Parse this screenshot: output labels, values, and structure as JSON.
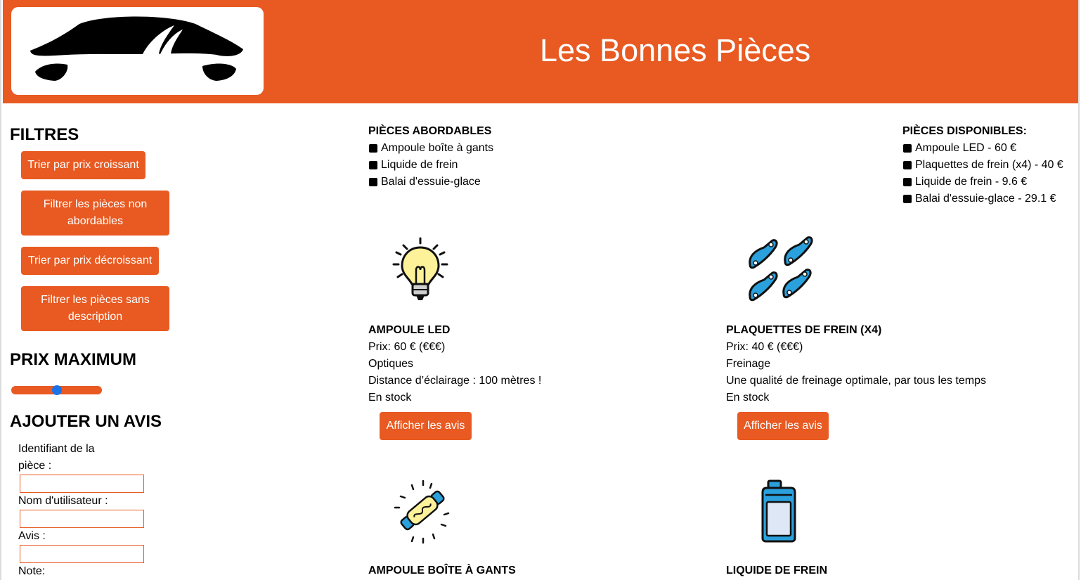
{
  "header": {
    "title": "Les Bonnes Pièces",
    "logo_icon": "car-silhouette-icon",
    "accent_color": "#e85a22"
  },
  "sidebar": {
    "filters_title": "FILTRES",
    "buttons": {
      "sort_asc": "Trier par prix croissant",
      "filter_unaffordable": "Filtrer les pièces non abordables",
      "sort_desc": "Trier par prix décroissant",
      "filter_no_description": "Filtrer les pièces sans description"
    },
    "price_max_title": "PRIX MAXIMUM",
    "price_slider_fraction": 0.5,
    "review_title": "AJOUTER UN AVIS",
    "form": {
      "piece_id_label": "Identifiant de la pièce :",
      "username_label": "Nom d'utilisateur :",
      "review_label": "Avis :",
      "note_label": "Note:"
    }
  },
  "affordable": {
    "title": "PIÈCES ABORDABLES",
    "items": [
      "Ampoule boîte à gants",
      "Liquide de frein",
      "Balai d'essuie-glace"
    ]
  },
  "available": {
    "title": "PIÈCES DISPONIBLES:",
    "items": [
      "Ampoule LED - 60 €",
      "Plaquettes de frein (x4) - 40 €",
      "Liquide de frein - 9.6 €",
      "Balai d'essuie-glace - 29.1 €"
    ]
  },
  "products": [
    {
      "icon": "light-bulb-icon",
      "name": "AMPOULE LED",
      "price": "Prix: 60 € (€€€)",
      "category": "Optiques",
      "description": "Distance d’éclairage : 100 mètres !",
      "stock": "En stock",
      "button": "Afficher les avis"
    },
    {
      "icon": "brake-pads-icon",
      "name": "PLAQUETTES DE FREIN (X4)",
      "price": "Prix: 40 € (€€€)",
      "category": "Freinage",
      "description": "Une qualité de freinage optimale, par tous les temps",
      "stock": "En stock",
      "button": "Afficher les avis"
    },
    {
      "icon": "glovebox-bulb-icon",
      "name": "AMPOULE BOÎTE À GANTS"
    },
    {
      "icon": "brake-fluid-can-icon",
      "name": "LIQUIDE DE FREIN"
    }
  ]
}
